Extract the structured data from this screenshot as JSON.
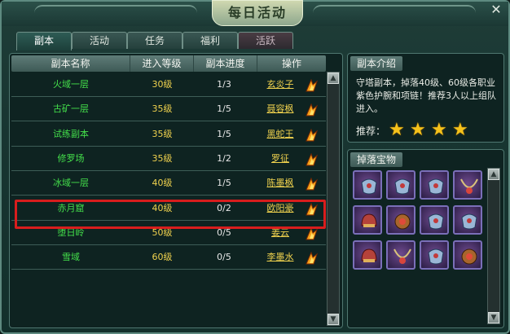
{
  "window": {
    "title": "每日活动",
    "close_glyph": "✕"
  },
  "tabs": [
    {
      "label": "副本",
      "state": "active"
    },
    {
      "label": "活动",
      "state": "normal"
    },
    {
      "label": "任务",
      "state": "normal"
    },
    {
      "label": "福利",
      "state": "normal"
    },
    {
      "label": "活跃",
      "state": "dim"
    }
  ],
  "table": {
    "headers": [
      "副本名称",
      "进入等级",
      "副本进度",
      "操作"
    ],
    "rows": [
      {
        "name": "火域一层",
        "level": "30级",
        "progress": "1/3",
        "npc": "玄炎子",
        "icon": "fire-quest-icon"
      },
      {
        "name": "古矿一层",
        "level": "35级",
        "progress": "1/5",
        "npc": "聂容枫",
        "icon": "fire-quest-icon"
      },
      {
        "name": "试练副本",
        "level": "35级",
        "progress": "1/5",
        "npc": "黑蛇王",
        "icon": "fire-quest-icon"
      },
      {
        "name": "修罗场",
        "level": "35级",
        "progress": "1/2",
        "npc": "罗征",
        "icon": "fire-quest-icon"
      },
      {
        "name": "冰域一层",
        "level": "40级",
        "progress": "1/5",
        "npc": "陈墨枫",
        "icon": "fire-quest-icon"
      },
      {
        "name": "赤月窟",
        "level": "40级",
        "progress": "0/2",
        "npc": "欧阳豪",
        "icon": "fire-quest-icon"
      },
      {
        "name": "堕日岭",
        "level": "50级",
        "progress": "0/5",
        "npc": "姜云",
        "icon": "fire-quest-icon"
      },
      {
        "name": "雪域",
        "level": "60级",
        "progress": "0/5",
        "npc": "李墨水",
        "icon": "fire-quest-icon"
      }
    ],
    "selected_row": "赤月窟"
  },
  "intro": {
    "title": "副本介绍",
    "text": "守塔副本，掉落40级、60级各职业紫色护腕和项链！推荐3人以上组队进入。",
    "recommend_label": "推荐：",
    "stars": 4,
    "star_icon": "star-icon"
  },
  "drops": {
    "title": "掉落宝物",
    "items": [
      "bracer-item-icon",
      "bracer-item-icon",
      "bracer-item-icon",
      "necklace-item-icon",
      "helmet-item-icon",
      "amulet-item-icon",
      "bracer-item-icon",
      "bracer-item-icon",
      "helmet-item-icon",
      "necklace-item-icon",
      "bracer-item-icon",
      "amulet-item-icon"
    ]
  },
  "colors": {
    "accent_green": "#44e04b",
    "accent_gold": "#f0d24e",
    "highlight_red": "#d81d1d"
  }
}
